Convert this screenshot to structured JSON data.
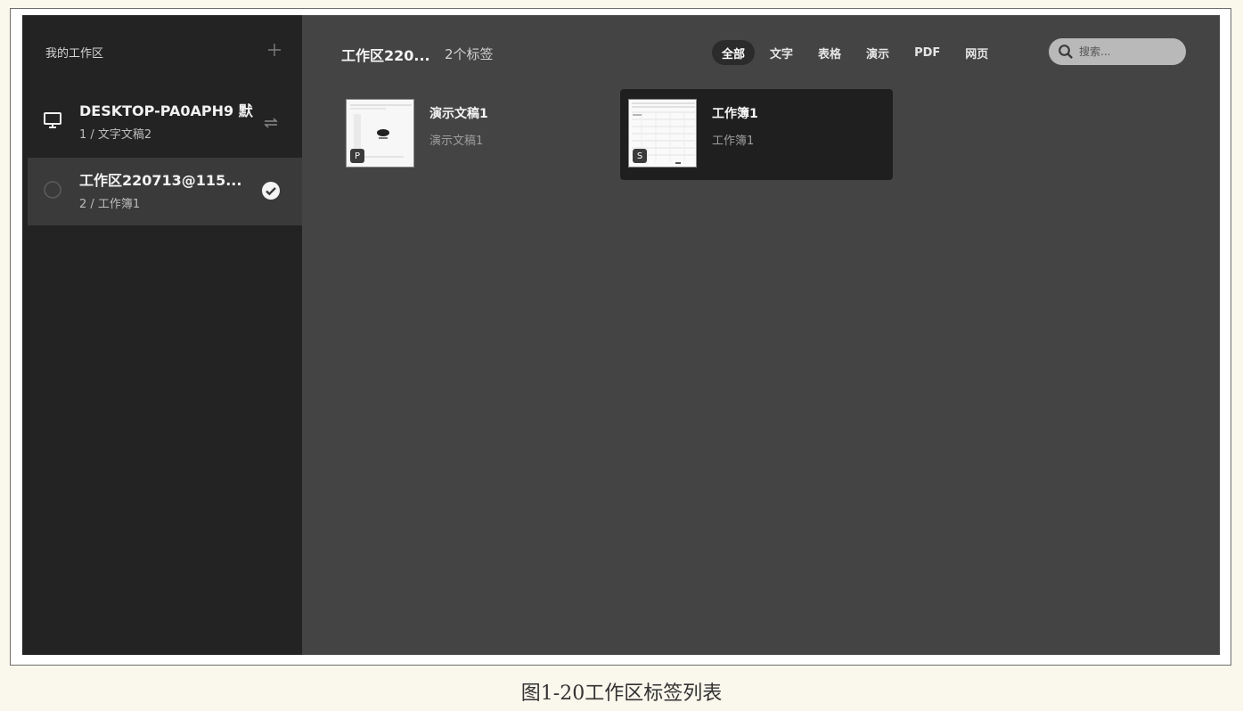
{
  "sidebar": {
    "title": "我的工作区",
    "add_icon": "plus-icon",
    "workspaces": [
      {
        "name": "DESKTOP-PA0APH9 默",
        "subtitle": "1 / 文字文稿2",
        "icon": "monitor-icon",
        "action_icon": "sync-arrows-icon",
        "active": false
      },
      {
        "name": "工作区220713@115...",
        "subtitle": "2 / 工作簿1",
        "icon": "radio-circle-icon",
        "action_icon": "check-circle-icon",
        "active": true
      }
    ]
  },
  "main": {
    "title": "工作区220...",
    "tab_count": "2个标签",
    "filters": [
      {
        "label": "全部",
        "active": true
      },
      {
        "label": "文字",
        "active": false
      },
      {
        "label": "表格",
        "active": false
      },
      {
        "label": "演示",
        "active": false
      },
      {
        "label": "PDF",
        "active": false
      },
      {
        "label": "网页",
        "active": false
      }
    ],
    "search": {
      "placeholder": "搜索..."
    },
    "tabs": [
      {
        "title": "演示文稿1",
        "subtitle": "演示文稿1",
        "type_badge": "P",
        "selected": false
      },
      {
        "title": "工作簿1",
        "subtitle": "工作簿1",
        "type_badge": "S",
        "selected": true
      }
    ]
  },
  "caption": "图1-20工作区标签列表",
  "colors": {
    "sidebar_bg": "#232323",
    "sidebar_active": "#3a3a3a",
    "main_bg": "#444444",
    "selected_card": "#1f1f1f",
    "search_bg": "#b9b9b9",
    "page_bg": "#faf7ec"
  }
}
